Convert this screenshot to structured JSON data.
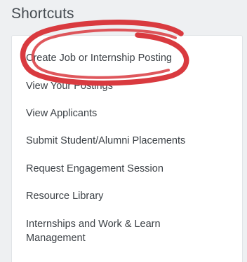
{
  "shortcuts": {
    "title": "Shortcuts",
    "items": [
      {
        "label": "Create Job or Internship Posting"
      },
      {
        "label": "View Your Postings"
      },
      {
        "label": "View Applicants"
      },
      {
        "label": "Submit Student/Alumni Placements"
      },
      {
        "label": "Request Engagement Session"
      },
      {
        "label": "Resource Library"
      },
      {
        "label": "Internships and Work & Learn Management"
      }
    ]
  },
  "annotation": {
    "color": "#d93a3f"
  }
}
